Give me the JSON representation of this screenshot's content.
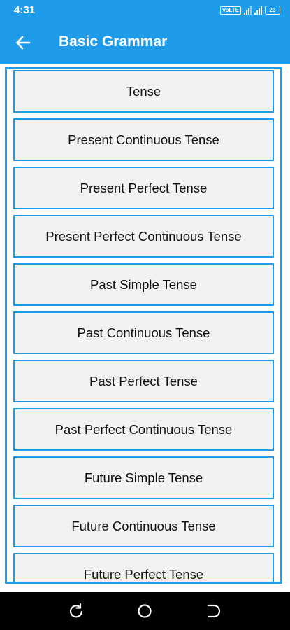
{
  "status_bar": {
    "time": "4:31",
    "volte_label": "VoLTE",
    "battery": "23"
  },
  "app_bar": {
    "title": "Basic Grammar",
    "back_icon": "arrow-left-icon"
  },
  "list": {
    "items": [
      {
        "label": "Tense"
      },
      {
        "label": "Present Continuous Tense"
      },
      {
        "label": "Present Perfect Tense"
      },
      {
        "label": "Present Perfect Continuous Tense"
      },
      {
        "label": "Past Simple Tense"
      },
      {
        "label": "Past Continuous Tense"
      },
      {
        "label": "Past Perfect Tense"
      },
      {
        "label": "Past Perfect Continuous Tense"
      },
      {
        "label": "Future Simple Tense"
      },
      {
        "label": "Future Continuous Tense"
      },
      {
        "label": "Future Perfect Tense"
      }
    ]
  },
  "nav_bar": {
    "recents_icon": "recents-icon",
    "home_icon": "home-icon",
    "back_icon": "back-icon"
  },
  "colors": {
    "primary": "#1e9be9",
    "item_background": "#f2f2f2",
    "nav_bar": "#000000"
  }
}
